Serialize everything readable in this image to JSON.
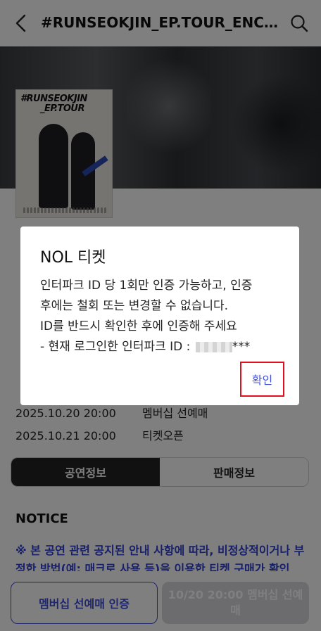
{
  "header": {
    "title": "#RUNSEOKJIN_EP.TOUR_ENCORE..."
  },
  "poster": {
    "title_line1": "#RUNSEOKJIN",
    "title_line2": "_EP.TOUR"
  },
  "schedule": [
    {
      "datetime": "2025.10.20 20:00",
      "label": "멤버십 선예매"
    },
    {
      "datetime": "2025.10.21 20:00",
      "label": "티켓오픈"
    }
  ],
  "tabs": [
    {
      "label": "공연정보",
      "active": true
    },
    {
      "label": "판매정보",
      "active": false
    }
  ],
  "notice": {
    "title": "NOTICE",
    "text": "※ 본 공연 관련 공지된 안내 사항에 따라, 비정상적이거나 부정한 방법(예: 매크로 사용 등)을 이용한 티켓 구매가 확인"
  },
  "bottom": {
    "member_button": "멤버십 선예매 인증",
    "presale_button": "10/20 20:00 멤버십 선예매"
  },
  "dialog": {
    "title": "NOL 티켓",
    "line1": "인터파크 ID 당 1회만 인증 가능하고, 인증",
    "line2": "후에는 철회 또는 변경할 수 없습니다.",
    "line3": "ID를 반드시 확인한 후에 인증해 주세요",
    "line4_prefix": "- 현재 로그인한 인터파크 ID :",
    "line4_suffix": "***",
    "confirm": "확인"
  },
  "colors": {
    "accent": "#3f4dd6",
    "notice": "#2f3fd4",
    "highlight_box": "#e0101c",
    "overlay": "rgba(0,0,0,0.5)"
  }
}
